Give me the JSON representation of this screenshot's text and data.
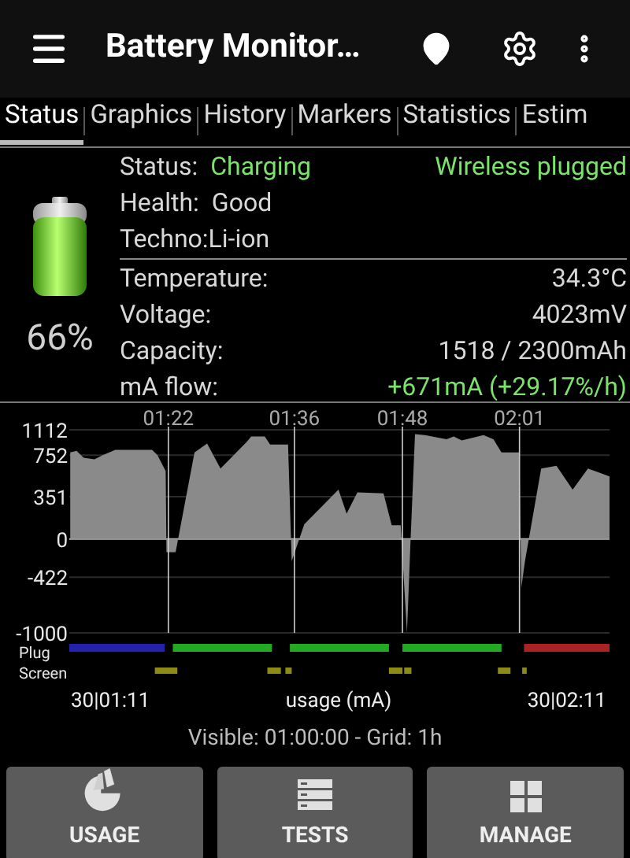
{
  "app_bar": {
    "title": "Battery Monitor…"
  },
  "tabs": [
    {
      "label": "Status",
      "selected": true
    },
    {
      "label": "Graphics",
      "selected": false
    },
    {
      "label": "History",
      "selected": false
    },
    {
      "label": "Markers",
      "selected": false
    },
    {
      "label": "Statistics",
      "selected": false
    },
    {
      "label": "Estim",
      "selected": false
    }
  ],
  "battery": {
    "percent": "66%"
  },
  "status": {
    "rows": [
      {
        "label": "Status:",
        "value": "Charging",
        "highlight": true
      },
      {
        "label": "Health:",
        "value": "Good",
        "highlight": false
      },
      {
        "label": "Techno:Li-ion"
      }
    ],
    "plug": "Wireless plugged"
  },
  "measurements": [
    {
      "label": "Temperature:",
      "value": "34.3°C",
      "highlight": false
    },
    {
      "label": "Voltage:",
      "value": "4023mV",
      "highlight": false
    },
    {
      "label": "Capacity:",
      "value": "1518 / 2300mAh",
      "highlight": false
    },
    {
      "label": "mA flow:",
      "value": "+671mA (+29.17%/h)",
      "highlight": true
    }
  ],
  "chart": {
    "time_labels": [
      "01:22",
      "01:36",
      "01:48",
      "02:01"
    ],
    "y_labels": [
      "1112",
      "752",
      "351",
      "0",
      "-422",
      "-1000"
    ],
    "plug_label": "Plug",
    "screen_label": "Screen",
    "start_label": "30|01:11",
    "axis_title": "usage (mA)",
    "end_label": "30|02:11"
  },
  "visible_note": "Visible: 01:00:00 - Grid: 1h",
  "buttons": [
    {
      "kind": "usage",
      "label": "USAGE"
    },
    {
      "kind": "tests",
      "label": "TESTS"
    },
    {
      "kind": "manage",
      "label": "MANAGE"
    }
  ]
}
